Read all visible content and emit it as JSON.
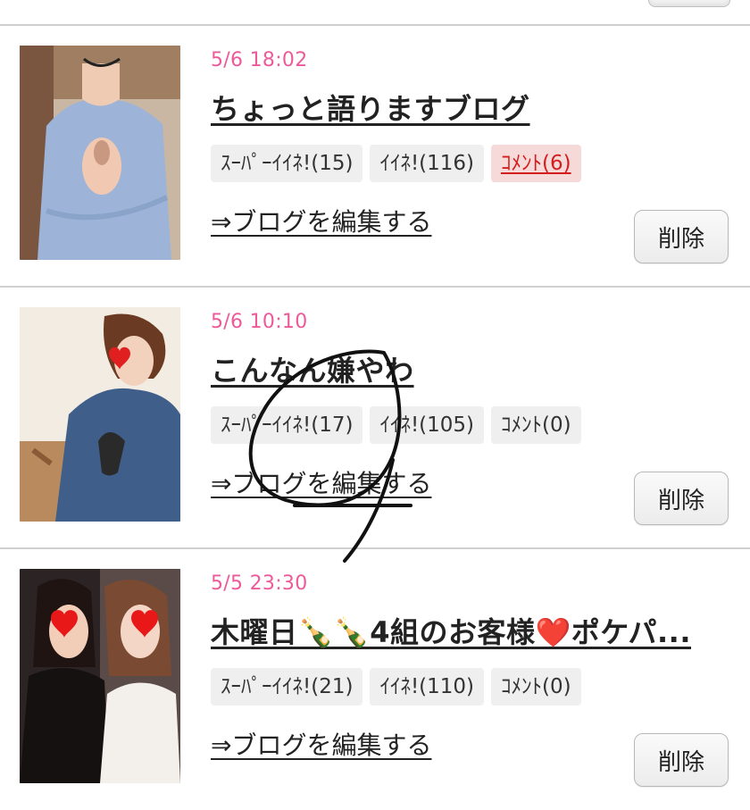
{
  "posts": [
    {
      "date": "5/6 18:02",
      "title": "ちょっと語りますブログ",
      "super_like": "ｽｰﾊﾟｰｲｲﾈ!(15)",
      "like": "ｲｲﾈ!(116)",
      "comment": "ｺﾒﾝﾄ(6)",
      "edit_link": "⇒ブログを編集する",
      "delete": "削除"
    },
    {
      "date": "5/6 10:10",
      "title": "こんなん嫌やわ",
      "super_like": "ｽｰﾊﾟｰｲｲﾈ!(17)",
      "like": "ｲｲﾈ!(105)",
      "comment": "ｺﾒﾝﾄ(0)",
      "edit_link": "⇒ブログを編集する",
      "delete": "削除"
    },
    {
      "date": "5/5 23:30",
      "title": "木曜日🍾🍾4組のお客様❤️ポケパ...",
      "super_like": "ｽｰﾊﾟｰｲｲﾈ!(21)",
      "like": "ｲｲﾈ!(110)",
      "comment": "ｺﾒﾝﾄ(0)",
      "edit_link": "⇒ブログを編集する",
      "delete": "削除"
    }
  ],
  "colors": {
    "date": "#ec5a9a",
    "comment_alert": "#d41e1e",
    "badge_bg": "#efefef",
    "divider": "#d0d0d0"
  }
}
